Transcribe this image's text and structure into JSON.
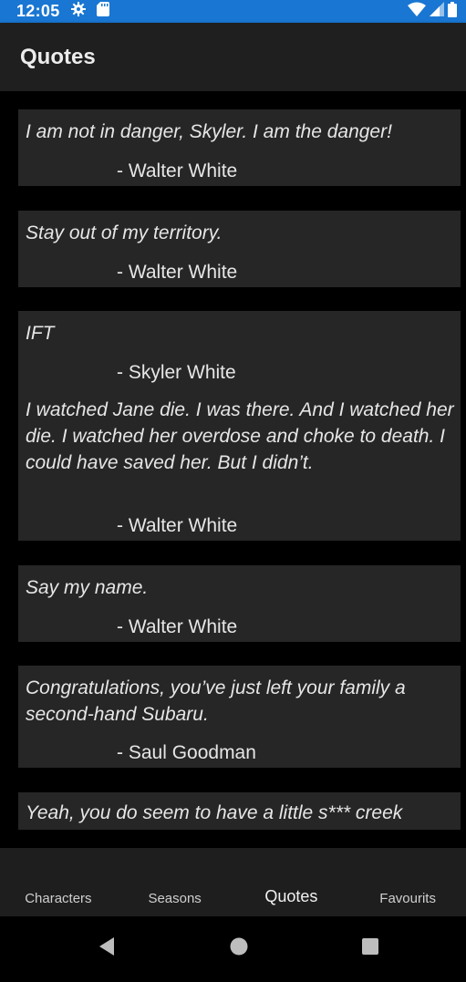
{
  "status_bar": {
    "time": "12:05",
    "background": "#1976d2"
  },
  "app_bar": {
    "title": "Quotes"
  },
  "quotes": [
    {
      "text": "I am not in danger, Skyler. I am the danger!",
      "author": "- Walter White"
    },
    {
      "text": "Stay out of my territory.",
      "author": "- Walter White"
    },
    {
      "text": "IFT",
      "author": "- Skyler White"
    },
    {
      "text": "I watched Jane die. I was there. And I watched her die. I watched her overdose and choke to death. I could have saved her. But I didn’t.",
      "author": "- Walter White"
    },
    {
      "text": "Say my name.",
      "author": "- Walter White"
    },
    {
      "text": "Congratulations, you’ve just left your family a second-hand Subaru.",
      "author": "- Saul Goodman"
    },
    {
      "text": "Yeah, you do seem to have a little s*** creek"
    }
  ],
  "bottom_nav": {
    "items": [
      {
        "label": "Characters",
        "active": false
      },
      {
        "label": "Seasons",
        "active": false
      },
      {
        "label": "Quotes",
        "active": true
      },
      {
        "label": "Favourits",
        "active": false
      }
    ]
  },
  "icons": {
    "status_left": [
      "gear-icon",
      "sd-card-icon"
    ],
    "status_right": [
      "wifi-icon",
      "signal-icon",
      "battery-icon"
    ],
    "system_nav": [
      "back-icon",
      "home-icon",
      "recents-icon"
    ]
  }
}
